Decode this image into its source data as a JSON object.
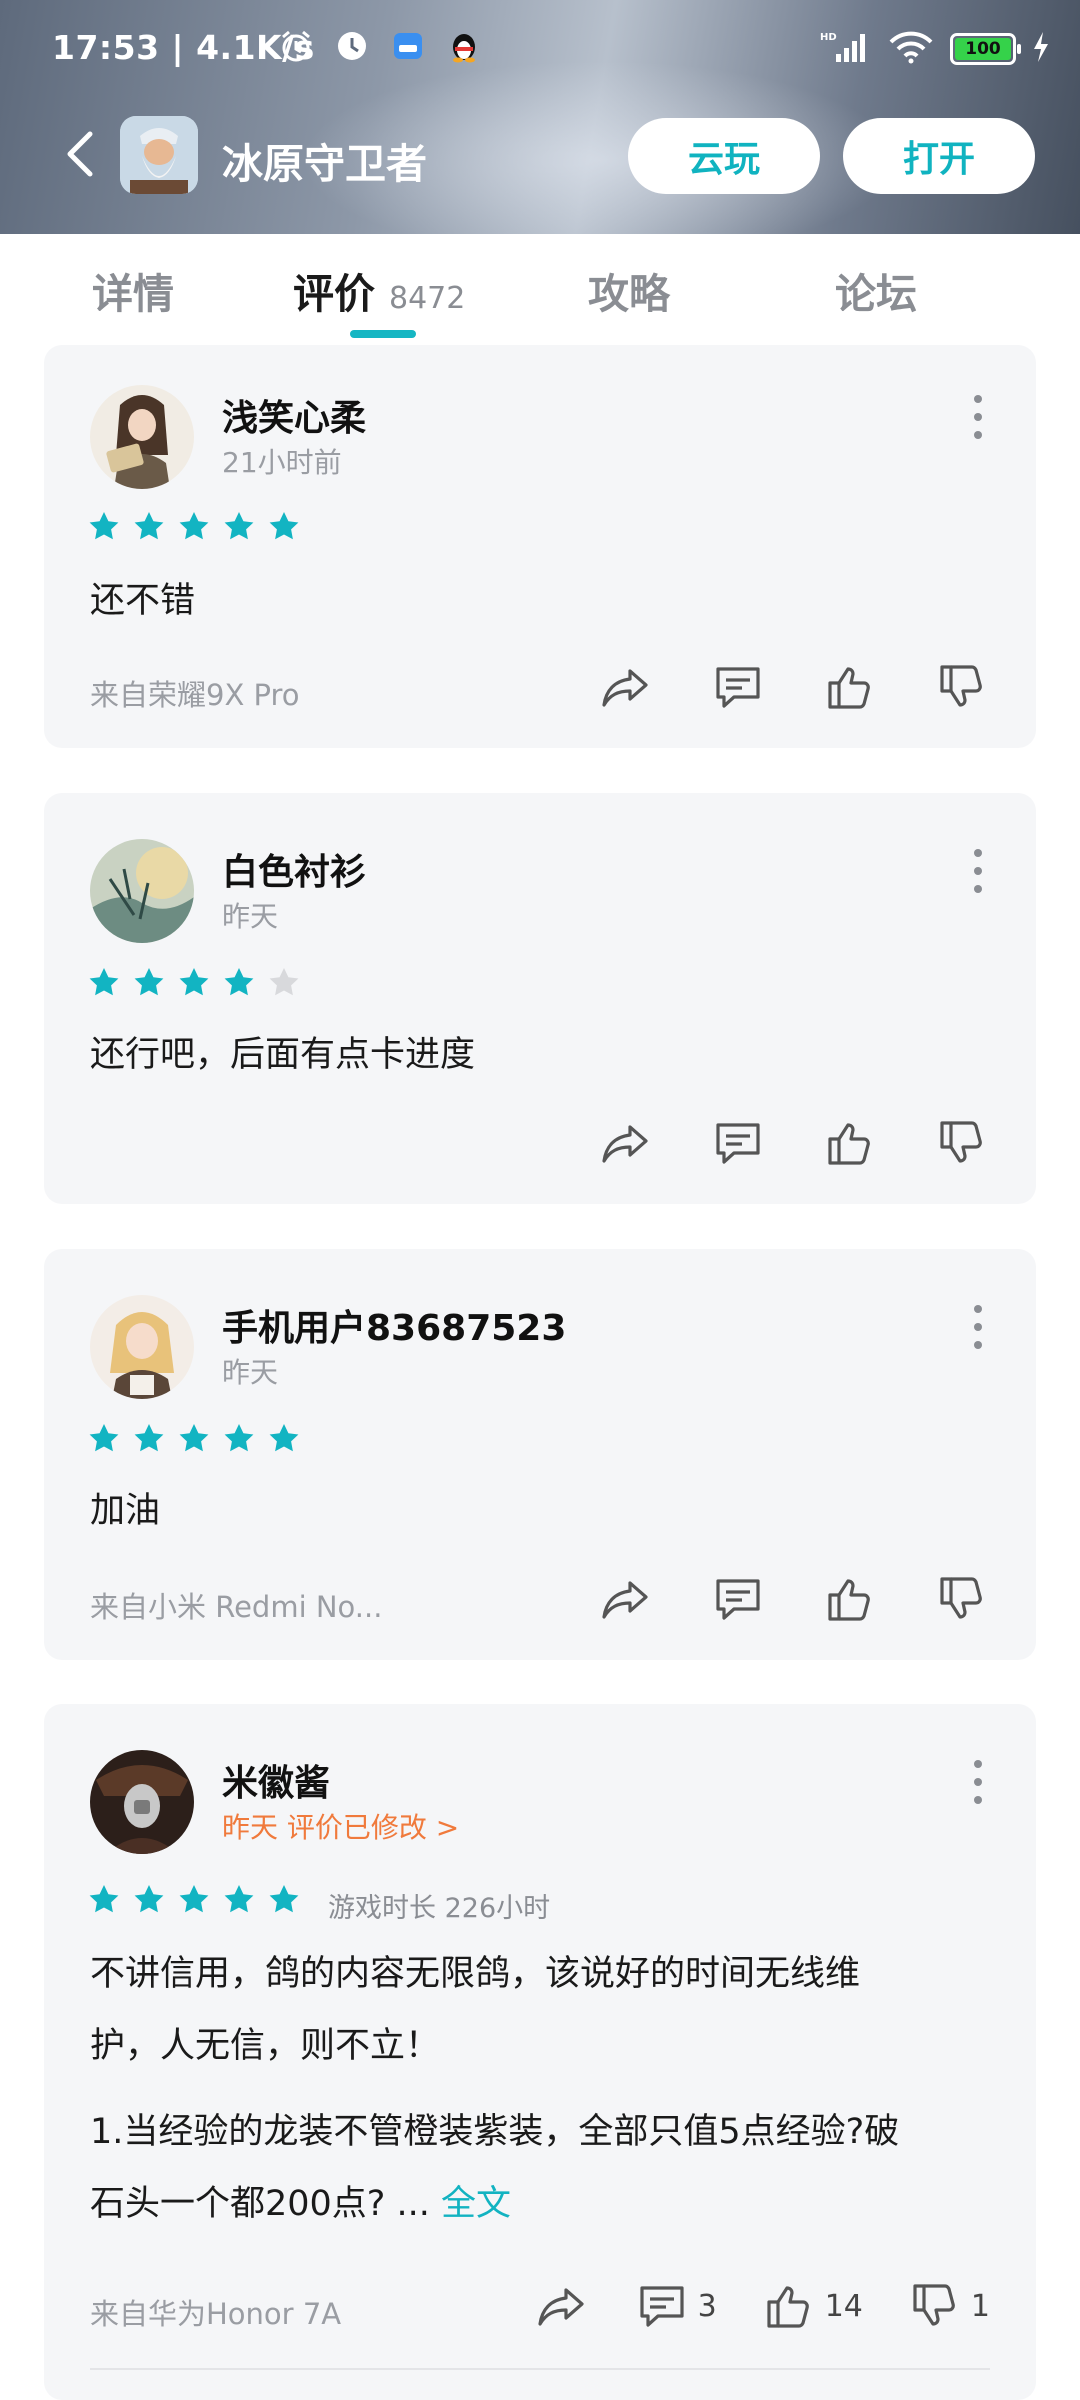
{
  "status_bar": {
    "time": "17:53 | 4.1K/s",
    "battery": "100",
    "icons": [
      "alarm-icon",
      "clock-icon",
      "app-notification-icon",
      "qq-penguin-icon",
      "hd-signal-icon",
      "wifi-icon",
      "charging-icon"
    ]
  },
  "header": {
    "app_title": "冰原守卫者",
    "cloud_play_label": "云玩",
    "open_label": "打开"
  },
  "tabs": [
    {
      "label": "详情"
    },
    {
      "label": "评价",
      "count": "8472"
    },
    {
      "label": "攻略"
    },
    {
      "label": "论坛"
    }
  ],
  "reviews": [
    {
      "username": "浅笑心柔",
      "time": "21小时前",
      "stars": 5,
      "text": "还不错",
      "device": "来自荣耀9X Pro"
    },
    {
      "username": "白色衬衫",
      "time": "昨天",
      "stars": 4,
      "text": "还行吧，后面有点卡进度",
      "device": ""
    },
    {
      "username": "手机用户83687523",
      "time": "昨天",
      "stars": 5,
      "text": "加油",
      "device": "来自小米 Redmi No..."
    },
    {
      "username": "米徽酱",
      "time": "昨天 评价已修改 >",
      "stars": 5,
      "playtime": "游戏时长 226小时",
      "text_line1": "不讲信用，鸽的内容无限鸽，该说好的时间无线维",
      "text_line2": "护，人无信，则不立！",
      "text_line3": "1.当经验的龙装不管橙装紫装，全部只值5点经验?破",
      "text_line4": "石头一个都200点? ...",
      "full_text_link": "全文",
      "device": "来自华为Honor 7A",
      "comments": "3",
      "likes": "14",
      "dislikes": "1"
    }
  ],
  "colors": {
    "accent": "#16b6c3",
    "star_filled": "#12b4c2",
    "star_empty": "#d8d9dc",
    "modified_orange": "#f07a3c"
  }
}
